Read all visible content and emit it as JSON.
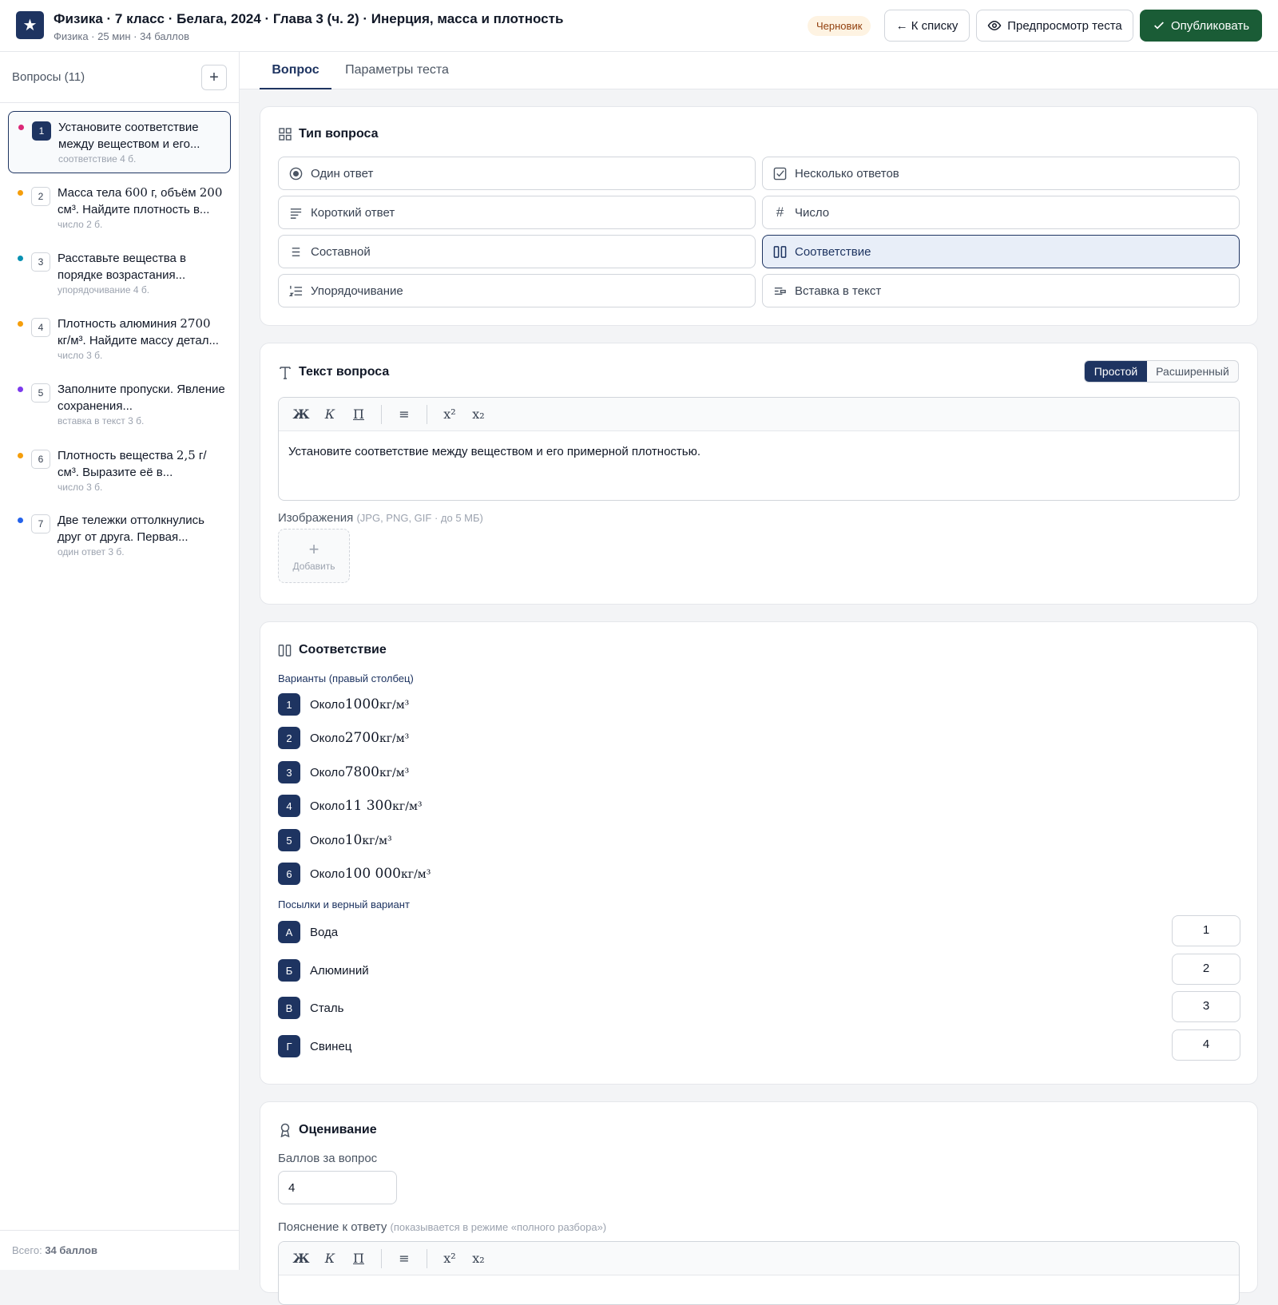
{
  "header": {
    "logo_icon": "star-icon",
    "title": "Физика · 7 класс · Белага, 2024 · Глава 3 (ч. 2) · Инерция, масса и плотность",
    "subtitle": "Физика · 25 мин · 34 баллов",
    "status_badge": "Черновик",
    "back_label": "← К списку",
    "preview_label": "Предпросмотр теста",
    "publish_label": "Опубликовать"
  },
  "sidebar": {
    "title": "Вопросы (11)",
    "add_icon": "plus-icon",
    "items": [
      {
        "num": "1",
        "text_parts": [
          "Установите соответствие между веществом и его..."
        ],
        "meta": "соответствие  4 б.",
        "dot": "#db2777"
      },
      {
        "num": "2",
        "pre": "Масса тела ",
        "m1": "600",
        "mid": " г, объём ",
        "m2": "200",
        "post": " см³. Найдите плотность в...",
        "meta": "число  2 б.",
        "dot": "#f59e0b"
      },
      {
        "num": "3",
        "text": "Расставьте вещества в порядке возрастания...",
        "meta": "упорядочивание  4 б.",
        "dot": "#0891b2"
      },
      {
        "num": "4",
        "pre": "Плотность алюминия ",
        "m1": "2700",
        "post": " кг/м³. Найдите массу детал...",
        "meta": "число  3 б.",
        "dot": "#f59e0b"
      },
      {
        "num": "5",
        "text": "Заполните пропуски. Явление сохранения...",
        "meta": "вставка в текст  3 б.",
        "dot": "#7c3aed"
      },
      {
        "num": "6",
        "pre": "Плотность вещества ",
        "m1": "2,5",
        "post": " г/см³. Выразите её в...",
        "meta": "число  3 б.",
        "dot": "#f59e0b"
      },
      {
        "num": "7",
        "text": "Две тележки оттолкнулись друг от друга. Первая...",
        "meta": "один ответ  3 б.",
        "dot": "#2563eb"
      }
    ],
    "total_label": "Всего:",
    "total_value": "34 баллов"
  },
  "tabs": [
    "Вопрос",
    "Параметры теста"
  ],
  "question_type": {
    "title": "Тип вопроса",
    "options": [
      {
        "label": "Один ответ",
        "icon": "radio-icon"
      },
      {
        "label": "Несколько ответов",
        "icon": "checkbox-icon"
      },
      {
        "label": "Короткий ответ",
        "icon": "text-lines-icon"
      },
      {
        "label": "Число",
        "icon": "hash-icon"
      },
      {
        "label": "Составной",
        "icon": "list-icon"
      },
      {
        "label": "Соответствие",
        "icon": "columns-icon",
        "selected": true
      },
      {
        "label": "Упорядочивание",
        "icon": "ordered-list-icon"
      },
      {
        "label": "Вставка в текст",
        "icon": "text-insert-icon"
      }
    ]
  },
  "question_text": {
    "title": "Текст вопроса",
    "mode_simple": "Простой",
    "mode_advanced": "Расширенный",
    "toolbar": [
      "Ж",
      "К",
      "П",
      "≡",
      "x²",
      "x₂"
    ],
    "body": "Установите соответствие между веществом и его примерной плотностью.",
    "images_label": "Изображения",
    "images_hint": "(JPG, PNG, GIF · до 5 МБ)",
    "add_image": "Добавить"
  },
  "matching": {
    "title": "Соответствие",
    "options_label": "Варианты (правый столбец)",
    "options": [
      {
        "num": "1",
        "pre": "Около",
        "value": "1000",
        "unit": "кг/м³"
      },
      {
        "num": "2",
        "pre": "Около",
        "value": "2700",
        "unit": "кг/м³"
      },
      {
        "num": "3",
        "pre": "Около",
        "value": "7800",
        "unit": "кг/м³"
      },
      {
        "num": "4",
        "pre": "Около",
        "value": "11 300",
        "unit": "кг/м³"
      },
      {
        "num": "5",
        "pre": "Около",
        "value": "10",
        "unit": "кг/м³"
      },
      {
        "num": "6",
        "pre": "Около",
        "value": "100 000",
        "unit": "кг/м³"
      }
    ],
    "premises_label": "Посылки и верный вариант",
    "premises": [
      {
        "letter": "А",
        "text": "Вода",
        "answer": "1"
      },
      {
        "letter": "Б",
        "text": "Алюминий",
        "answer": "2"
      },
      {
        "letter": "В",
        "text": "Сталь",
        "answer": "3"
      },
      {
        "letter": "Г",
        "text": "Свинец",
        "answer": "4"
      }
    ]
  },
  "grading": {
    "title": "Оценивание",
    "points_label": "Баллов за вопрос",
    "points_value": "4",
    "explanation_label": "Пояснение к ответу",
    "explanation_hint": "(показывается в режиме «полного разбора»)",
    "toolbar": [
      "Ж",
      "К",
      "П",
      "≡",
      "x²",
      "x₂"
    ]
  },
  "colors": {
    "primary": "#1e3461",
    "publish": "#1a5c36",
    "draft_bg": "#fef3e2"
  }
}
